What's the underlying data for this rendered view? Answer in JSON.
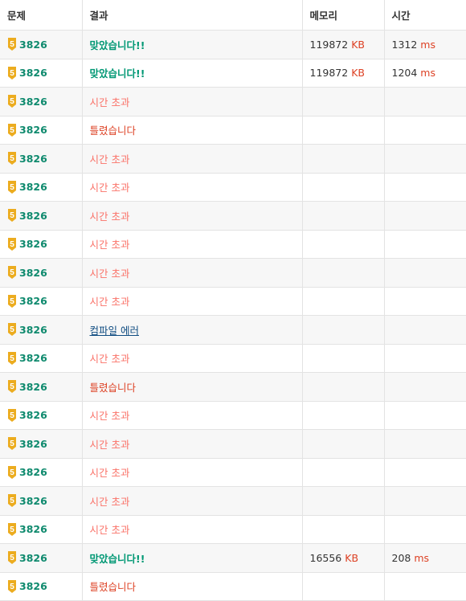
{
  "headers": {
    "problem": "문제",
    "result": "결과",
    "memory": "메모리",
    "time": "시간"
  },
  "tier_badge": {
    "icon": "silver-5-tier-icon",
    "label": "5",
    "color": "#ecac1f"
  },
  "rows": [
    {
      "problem": "3826",
      "result": "맞았습니다!!",
      "type": "ac",
      "memory": "119872",
      "memory_unit": "KB",
      "time": "1312",
      "time_unit": "ms"
    },
    {
      "problem": "3826",
      "result": "맞았습니다!!",
      "type": "ac",
      "memory": "119872",
      "memory_unit": "KB",
      "time": "1204",
      "time_unit": "ms"
    },
    {
      "problem": "3826",
      "result": "시간 초과",
      "type": "tle"
    },
    {
      "problem": "3826",
      "result": "틀렸습니다",
      "type": "wa"
    },
    {
      "problem": "3826",
      "result": "시간 초과",
      "type": "tle"
    },
    {
      "problem": "3826",
      "result": "시간 초과",
      "type": "tle"
    },
    {
      "problem": "3826",
      "result": "시간 초과",
      "type": "tle"
    },
    {
      "problem": "3826",
      "result": "시간 초과",
      "type": "tle"
    },
    {
      "problem": "3826",
      "result": "시간 초과",
      "type": "tle"
    },
    {
      "problem": "3826",
      "result": "시간 초과",
      "type": "tle"
    },
    {
      "problem": "3826",
      "result": "컴파일 에러",
      "type": "ce"
    },
    {
      "problem": "3826",
      "result": "시간 초과",
      "type": "tle"
    },
    {
      "problem": "3826",
      "result": "틀렸습니다",
      "type": "wa"
    },
    {
      "problem": "3826",
      "result": "시간 초과",
      "type": "tle"
    },
    {
      "problem": "3826",
      "result": "시간 초과",
      "type": "tle"
    },
    {
      "problem": "3826",
      "result": "시간 초과",
      "type": "tle"
    },
    {
      "problem": "3826",
      "result": "시간 초과",
      "type": "tle"
    },
    {
      "problem": "3826",
      "result": "시간 초과",
      "type": "tle"
    },
    {
      "problem": "3826",
      "result": "맞았습니다!!",
      "type": "ac",
      "memory": "16556",
      "memory_unit": "KB",
      "time": "208",
      "time_unit": "ms"
    },
    {
      "problem": "3826",
      "result": "틀렸습니다",
      "type": "wa"
    }
  ]
}
